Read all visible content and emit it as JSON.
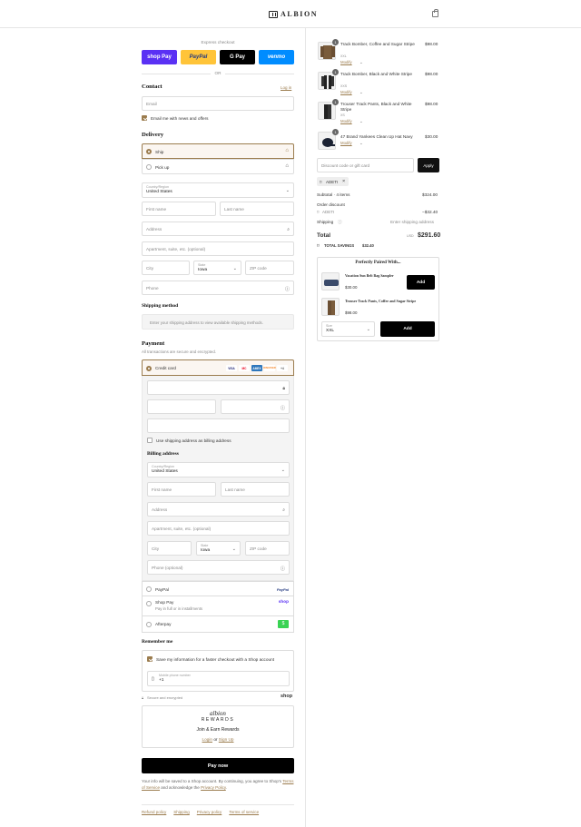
{
  "brand": "ALBION",
  "express": {
    "title": "Express checkout",
    "buttons": [
      "shop Pay",
      "PayPal",
      "G Pay",
      "venmo"
    ],
    "or": "OR"
  },
  "contact": {
    "title": "Contact",
    "login": "Log in",
    "email_placeholder": "Email",
    "news_label": "Email me with news and offers"
  },
  "delivery": {
    "title": "Delivery",
    "options": [
      "Ship",
      "Pick up"
    ],
    "country_label": "Country/Region",
    "country_value": "United States",
    "first_name": "First name",
    "last_name": "Last name",
    "address": "Address",
    "apartment": "Apartment, suite, etc. (optional)",
    "city": "City",
    "state_label": "State",
    "state_value": "Iowa",
    "zip": "ZIP code",
    "phone": "Phone"
  },
  "shipping_method": {
    "title": "Shipping method",
    "note": "Enter your shipping address to view available shipping methods."
  },
  "payment": {
    "title": "Payment",
    "subtitle": "All transactions are secure and encrypted.",
    "credit_card": "Credit card",
    "card_brands": [
      "VISA",
      "MC",
      "AMEX",
      "DISCOVER",
      "+4"
    ],
    "use_shipping": "Use shipping address as billing address",
    "billing_title": "Billing address",
    "phone_optional": "Phone (optional)",
    "paypal": "PayPal",
    "paypal_logo": "PayPal",
    "shop_pay": "Shop Pay",
    "shop_pay_sub": "Pay in full or in installments",
    "shop_logo": "shop",
    "afterpay": "Afterpay",
    "afterpay_logo": "$"
  },
  "remember": {
    "title": "Remember me",
    "save_label": "Save my information for a faster checkout with a Shop account",
    "mobile_label": "Mobile phone number",
    "mobile_value": "+1",
    "secure": "Secure and encrypted",
    "shop": "shop"
  },
  "rewards": {
    "script": "albion",
    "word": "REWARDS",
    "join": "Join & Earn Rewards",
    "login": "Login",
    "or": "or",
    "signup": "Sign Up"
  },
  "pay_now": "Pay now",
  "legal": {
    "text1": "Your info will be saved to a Shop account. By continuing, you agree to Shop's",
    "tos": "Terms of Service",
    "text2": "and acknowledge the",
    "privacy": "Privacy Policy",
    "end": "."
  },
  "footer_links": [
    "Refund policy",
    "Shipping",
    "Privacy policy",
    "Terms of service"
  ],
  "cart": {
    "items": [
      {
        "name": "Track Bomber, Coffee and Sugar Stripe",
        "variant": "XXL",
        "qty": "1",
        "price": "$98.00",
        "modify": "Modify"
      },
      {
        "name": "Track Bomber, Black and White Stripe",
        "variant": "XXS",
        "qty": "1",
        "price": "$98.00",
        "modify": "Modify"
      },
      {
        "name": "Trouser Track Pants, Black and White Stripe",
        "variant": "XS",
        "qty": "1",
        "price": "$98.00",
        "modify": "Modify"
      },
      {
        "name": "47 Brand Yankees Clean Up Hat Navy",
        "variant": "",
        "qty": "1",
        "price": "$30.00",
        "modify": "Modify"
      }
    ],
    "discount_placeholder": "Discount code or gift card",
    "apply": "Apply",
    "code_chip": "ADETI",
    "subtotal_label": "Subtotal · 4 items",
    "subtotal_value": "$324.00",
    "order_discount": "Order discount",
    "discount_code": "ADETI",
    "discount_value": "−$32.40",
    "shipping_label": "Shipping",
    "shipping_value": "Enter shipping address",
    "total_label": "Total",
    "currency": "USD",
    "total_value": "$291.60",
    "savings_label": "TOTAL SAVINGS",
    "savings_value": "$32.40"
  },
  "upsell": {
    "title": "Perfectly Paired With...",
    "items": [
      {
        "name": "Vacation Sun Belt Bag Sampler",
        "price": "$30.00",
        "add": "Add"
      },
      {
        "name": "Trouser Track Pants, Coffee and Sugar Stripe",
        "price": "$98.00",
        "add": "Add"
      }
    ],
    "size_label": "Size",
    "size_value": "XXL"
  },
  "colors": {
    "accent": "#9b7c4e",
    "shop_purple": "#5a31f4",
    "paypal_yellow": "#ffc439",
    "venmo_blue": "#008cff"
  }
}
